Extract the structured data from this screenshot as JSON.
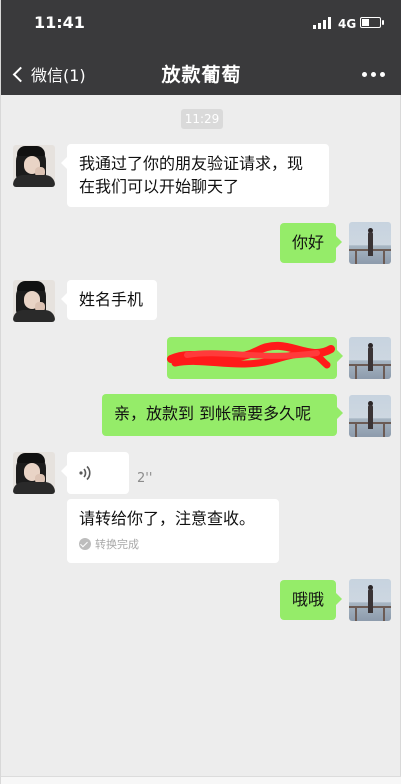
{
  "status_bar": {
    "time": "11:41",
    "network": "4G",
    "battery_level": 0.45
  },
  "nav": {
    "back_label": "微信(1)",
    "title": "放款葡萄",
    "more_icon": "more-dots-icon"
  },
  "chat": {
    "timestamp": "11:29",
    "messages": [
      {
        "side": "left",
        "text": "我通过了你的朋友验证请求，现在我们可以开始聊天了"
      },
      {
        "side": "right",
        "text": "你好"
      },
      {
        "side": "left",
        "text": "姓名手机"
      },
      {
        "side": "right",
        "text": "",
        "redacted": true
      },
      {
        "side": "right",
        "text": "亲，放款到 到帐需要多久呢"
      },
      {
        "side": "left",
        "type": "voice",
        "duration": "2''"
      },
      {
        "side": "left",
        "type": "transcript",
        "text": "请转给你了，注意查收。",
        "status": "转换完成"
      },
      {
        "side": "right",
        "text": "哦哦"
      }
    ],
    "line1": "我通过了你的朋友验证请求，现",
    "line2": "在我们可以开始聊天了"
  },
  "colors": {
    "header_bg": "#3a3a3c",
    "chat_bg": "#ededed",
    "outgoing_bubble": "#95ec69",
    "incoming_bubble": "#ffffff",
    "redaction": "#ff1a1a"
  }
}
